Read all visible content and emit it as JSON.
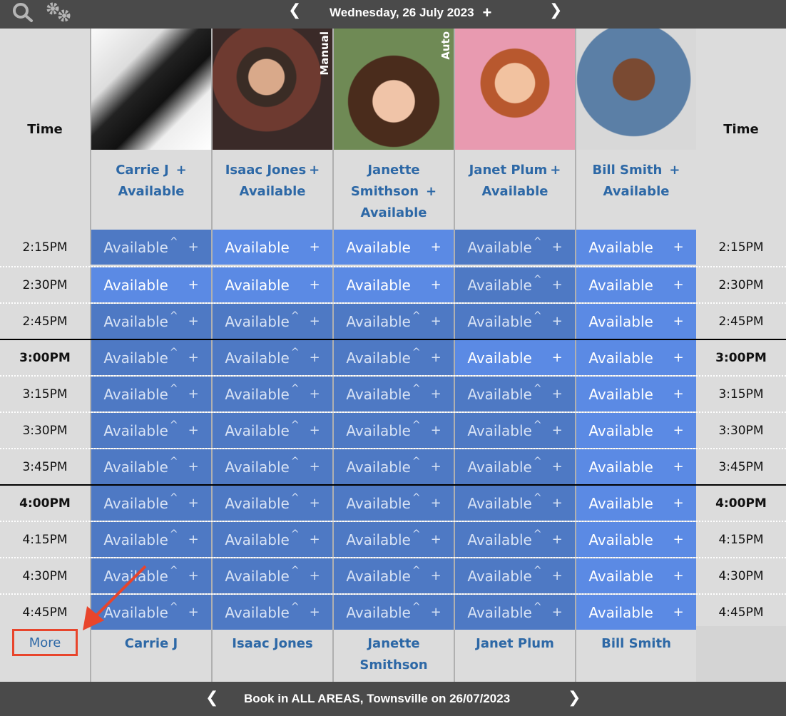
{
  "toolbar": {
    "search_icon": "search-icon",
    "settings_icon": "gears-icon",
    "prev_label": "‹",
    "date": "Wednesday, 26 July 2023",
    "add_label": "+",
    "next_label": "›"
  },
  "grid": {
    "time_header": "Time",
    "staff": [
      {
        "name": "Carrie J",
        "status": "Available",
        "add": "+",
        "tag": ""
      },
      {
        "name": "Isaac Jones",
        "status": "Available",
        "add": "+",
        "tag": "Manual"
      },
      {
        "name": "Janette Smithson",
        "status": "Available",
        "add": "+",
        "tag": "Auto"
      },
      {
        "name": "Janet Plum",
        "status": "Available",
        "add": "+",
        "tag": ""
      },
      {
        "name": "Bill Smith",
        "status": "Available",
        "add": "+",
        "tag": ""
      }
    ],
    "slot_label": "Available",
    "slot_caret": "^",
    "slot_add": "+",
    "rows": [
      {
        "time": "2:15PM",
        "hour": false,
        "cells": [
          "dark",
          "light",
          "light",
          "dark",
          "light"
        ]
      },
      {
        "time": "2:30PM",
        "hour": false,
        "cells": [
          "light",
          "light",
          "light",
          "dark",
          "light"
        ]
      },
      {
        "time": "2:45PM",
        "hour": false,
        "cells": [
          "dark",
          "dark",
          "dark",
          "dark",
          "light"
        ]
      },
      {
        "time": "3:00PM",
        "hour": true,
        "cells": [
          "dark",
          "dark",
          "dark",
          "light",
          "light"
        ]
      },
      {
        "time": "3:15PM",
        "hour": false,
        "cells": [
          "dark",
          "dark",
          "dark",
          "dark",
          "light"
        ]
      },
      {
        "time": "3:30PM",
        "hour": false,
        "cells": [
          "dark",
          "dark",
          "dark",
          "dark",
          "light"
        ]
      },
      {
        "time": "3:45PM",
        "hour": false,
        "cells": [
          "dark",
          "dark",
          "dark",
          "dark",
          "light"
        ]
      },
      {
        "time": "4:00PM",
        "hour": true,
        "cells": [
          "dark",
          "dark",
          "dark",
          "dark",
          "light"
        ]
      },
      {
        "time": "4:15PM",
        "hour": false,
        "cells": [
          "dark",
          "dark",
          "dark",
          "dark",
          "light"
        ]
      },
      {
        "time": "4:30PM",
        "hour": false,
        "cells": [
          "dark",
          "dark",
          "dark",
          "dark",
          "light"
        ]
      },
      {
        "time": "4:45PM",
        "hour": false,
        "cells": [
          "dark",
          "dark",
          "dark",
          "dark",
          "light"
        ]
      }
    ],
    "more_label": "More"
  },
  "footer": {
    "prev_label": "‹",
    "text": "Book in ALL AREAS, Townsville on 26/07/2023",
    "next_label": "›"
  },
  "colors": {
    "topbar": "#4a4a4a",
    "slot_booked_dark": "#4e79c4",
    "slot_available_light": "#5b8ae4",
    "link": "#2d68a6",
    "highlight": "#e8452c"
  }
}
